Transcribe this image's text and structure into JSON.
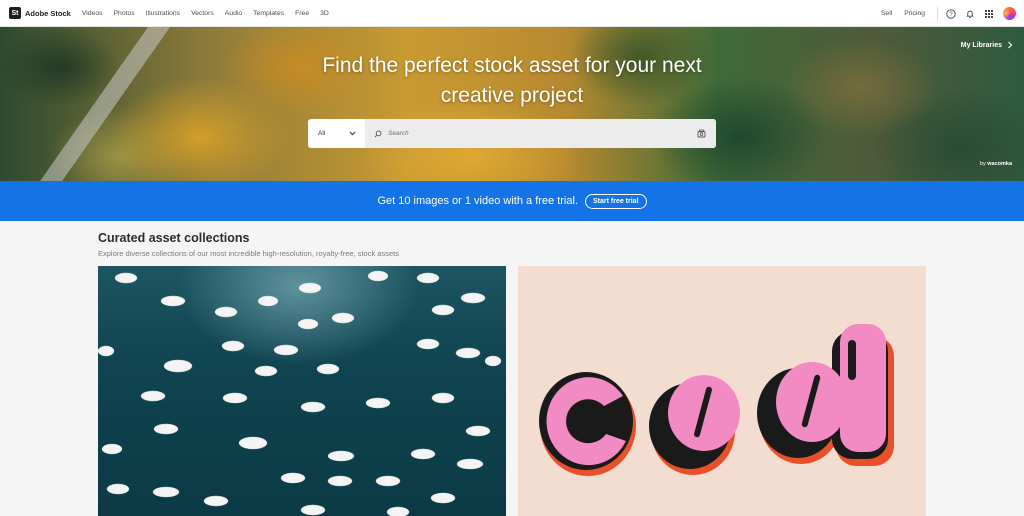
{
  "nav": {
    "brand": "Adobe Stock",
    "brand_mark": "St",
    "links": [
      "Videos",
      "Photos",
      "Illustrations",
      "Vectors",
      "Audio",
      "Templates",
      "Free",
      "3D"
    ],
    "sell": "Sell",
    "pricing": "Pricing",
    "icons": [
      "help-icon",
      "bell-icon",
      "apps-grid-icon",
      "user-avatar"
    ]
  },
  "hero": {
    "title_line1": "Find the perfect stock asset for your next",
    "title_line2": "creative project",
    "category": "All",
    "search_placeholder": "Search",
    "my_libraries": "My Libraries",
    "credit_prefix": "by",
    "credit_name": "wacomka"
  },
  "promo": {
    "text": "Get 10 images or 1 video with a free trial.",
    "button": "Start free trial",
    "color": "#1473e6"
  },
  "collections": {
    "title": "Curated asset collections",
    "subtitle": "Explore diverse collections of our most incredible high-resolution, royalty-free, stock assets",
    "cards": [
      "swans-photo",
      "cool-3d-lettering"
    ]
  }
}
